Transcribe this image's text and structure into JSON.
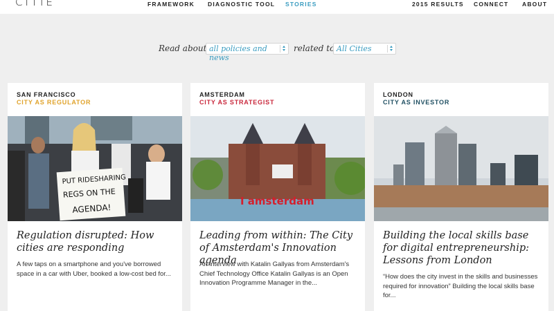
{
  "brand": "CITIE",
  "nav": {
    "framework": "FRAMEWORK",
    "diagnostic": "DIAGNOSTIC TOOL",
    "stories": "STORIES",
    "results": "2015 RESULTS",
    "connect": "CONNECT",
    "about": "ABOUT"
  },
  "filter": {
    "read_about": "Read about",
    "topic_value": "all policies and news",
    "related_to": "related to",
    "city_value": "All Cities"
  },
  "colors": {
    "accent": "#3a9cc0",
    "regulator": "#e0a32b",
    "strategist": "#c9283c",
    "investor": "#1f4f62"
  },
  "cards": [
    {
      "city": "SAN FRANCISCO",
      "role": "CITY AS REGULATOR",
      "sign_text": [
        "PUT RIDESHARING",
        "REGS ON THE",
        "AGENDA!"
      ],
      "title": "Regulation disrupted: How cities are responding",
      "excerpt": "A few taps on a smartphone and you've borrowed space in a car with Uber, booked a low-cost bed for..."
    },
    {
      "city": "AMSTERDAM",
      "role": "CITY AS STRATEGIST",
      "sign_text": [
        "I amsterdam"
      ],
      "title": "Leading from within: The City of Amsterdam's Innovation agenda",
      "excerpt": "An interview with Katalin Gallyas from Amsterdam's Chief Technology Office Katalin Gallyas is an Open Innovation Programme Manager in the..."
    },
    {
      "city": "LONDON",
      "role": "CITY AS INVESTOR",
      "title": "Building the local skills base for digital entrepreneurship: Lessons from London",
      "excerpt": "“How does the city invest in the skills and businesses required for innovation”   Building the local skills base for..."
    }
  ]
}
